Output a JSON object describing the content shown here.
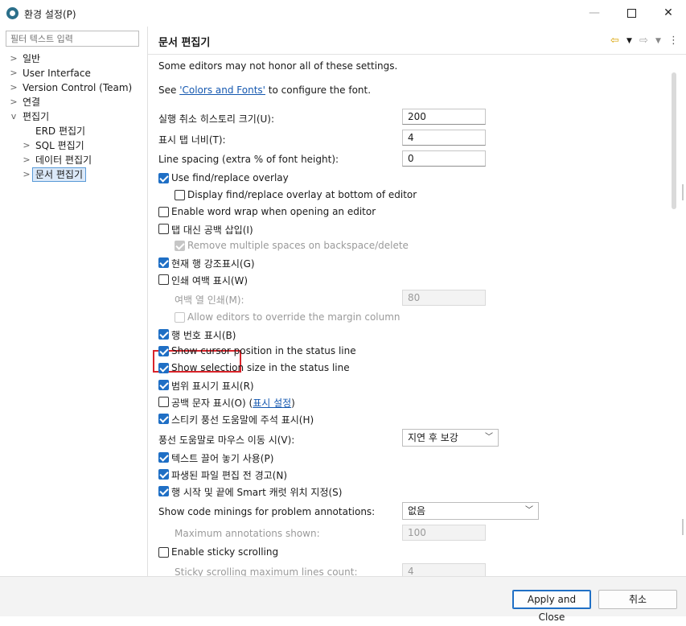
{
  "window": {
    "title": "환경 설정(P)"
  },
  "sidebar": {
    "filter_placeholder": "필터 텍스트 입력",
    "items": [
      {
        "label": "일반",
        "chevron": ">"
      },
      {
        "label": "User Interface",
        "chevron": ">"
      },
      {
        "label": "Version Control (Team)",
        "chevron": ">"
      },
      {
        "label": "연결",
        "chevron": ">"
      },
      {
        "label": "편집기",
        "chevron": "v"
      },
      {
        "label": "ERD 편집기",
        "chevron": ""
      },
      {
        "label": "SQL 편집기",
        "chevron": ">"
      },
      {
        "label": "데이터 편집기",
        "chevron": ">"
      },
      {
        "label": "문서 편집기",
        "chevron": ">"
      }
    ]
  },
  "page": {
    "title": "문서 편집기",
    "nav": {
      "back": "⇦",
      "forward": "⇨",
      "menu": "⋮"
    },
    "note": "Some editors may not honor all of these settings.",
    "see_prefix": "See ",
    "see_link": "'Colors and Fonts'",
    "see_suffix": " to configure the font.",
    "undo_label": "실행 취소 히스토리 크기(U):",
    "undo_value": "200",
    "tab_width_label": "표시 탭 너비(T):",
    "tab_width_value": "4",
    "line_spacing_label": "Line spacing (extra % of font height):",
    "line_spacing_value": "0",
    "findreplace": "Use find/replace overlay",
    "findreplace_bottom": "Display find/replace overlay at bottom of editor",
    "word_wrap": "Enable word wrap when opening an editor",
    "spaces_for_tabs": "탭 대신 공백 삽입(I)",
    "remove_spaces": "Remove multiple spaces on backspace/delete",
    "highlight_line": "현재 행 강조표시(G)",
    "print_margin": "인쇄 여백 표시(W)",
    "margin_col_label": "여백 열 인쇄(M):",
    "margin_col_value": "80",
    "allow_override": "Allow editors to override the margin column",
    "line_numbers": "행 번호 표시(B)",
    "cursor_pos": "Show cursor position in the status line",
    "selection_size": "Show selection size in the status line",
    "range_indicator": "범위 표시기 표시(R)",
    "whitespace": "공백 문자 표시(O) (",
    "whitespace_link": "표시 설정",
    "whitespace_end": ")",
    "sticky_hover": "스티키 풍선 도움말에 주석 표시(H)",
    "hover_label": "풍선 도움말로 마우스 이동 시(V):",
    "hover_value": "지연 후 보강",
    "drag_drop": "텍스트 끌어 놓기 사용(P)",
    "derived_warn": "파생된 파일 편집 전 경고(N)",
    "smart_caret": "행 시작 및 끝에 Smart 캐럿 위치 지정(S)",
    "minings_label": "Show code minings for problem annotations:",
    "minings_value": "없음",
    "max_annot_label": "Maximum annotations shown:",
    "max_annot_value": "100",
    "sticky_scroll": "Enable sticky scrolling",
    "sticky_max_label": "Sticky scrolling maximum lines count:",
    "sticky_max_value": "4"
  },
  "footer": {
    "apply_close": "Apply and Close",
    "cancel": "취소"
  }
}
